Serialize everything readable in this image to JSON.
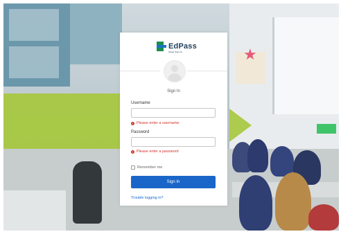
{
  "brand": {
    "name": "EdPass",
    "tagline": "Single Sign-On",
    "colors": {
      "green": "#1d8e4b",
      "blue": "#1b73c9",
      "text": "#1f3d5a"
    }
  },
  "form": {
    "heading": "Sign In",
    "username": {
      "label": "Username",
      "value": "",
      "placeholder": "",
      "error": "Please enter a username"
    },
    "password": {
      "label": "Password",
      "value": "",
      "placeholder": "",
      "error": "Please enter a password"
    },
    "remember_me": {
      "label": "Remember me",
      "checked": false
    },
    "submit_label": "Sign In",
    "help_link": "Trouble logging in?"
  },
  "icons": {
    "avatar": "user-avatar-icon",
    "error": "error-circle-icon",
    "logo": "edpass-logo-icon"
  },
  "colors": {
    "primary_button": "#1a66c8",
    "error": "#d0342c",
    "accent_green": "#a6c83a"
  }
}
